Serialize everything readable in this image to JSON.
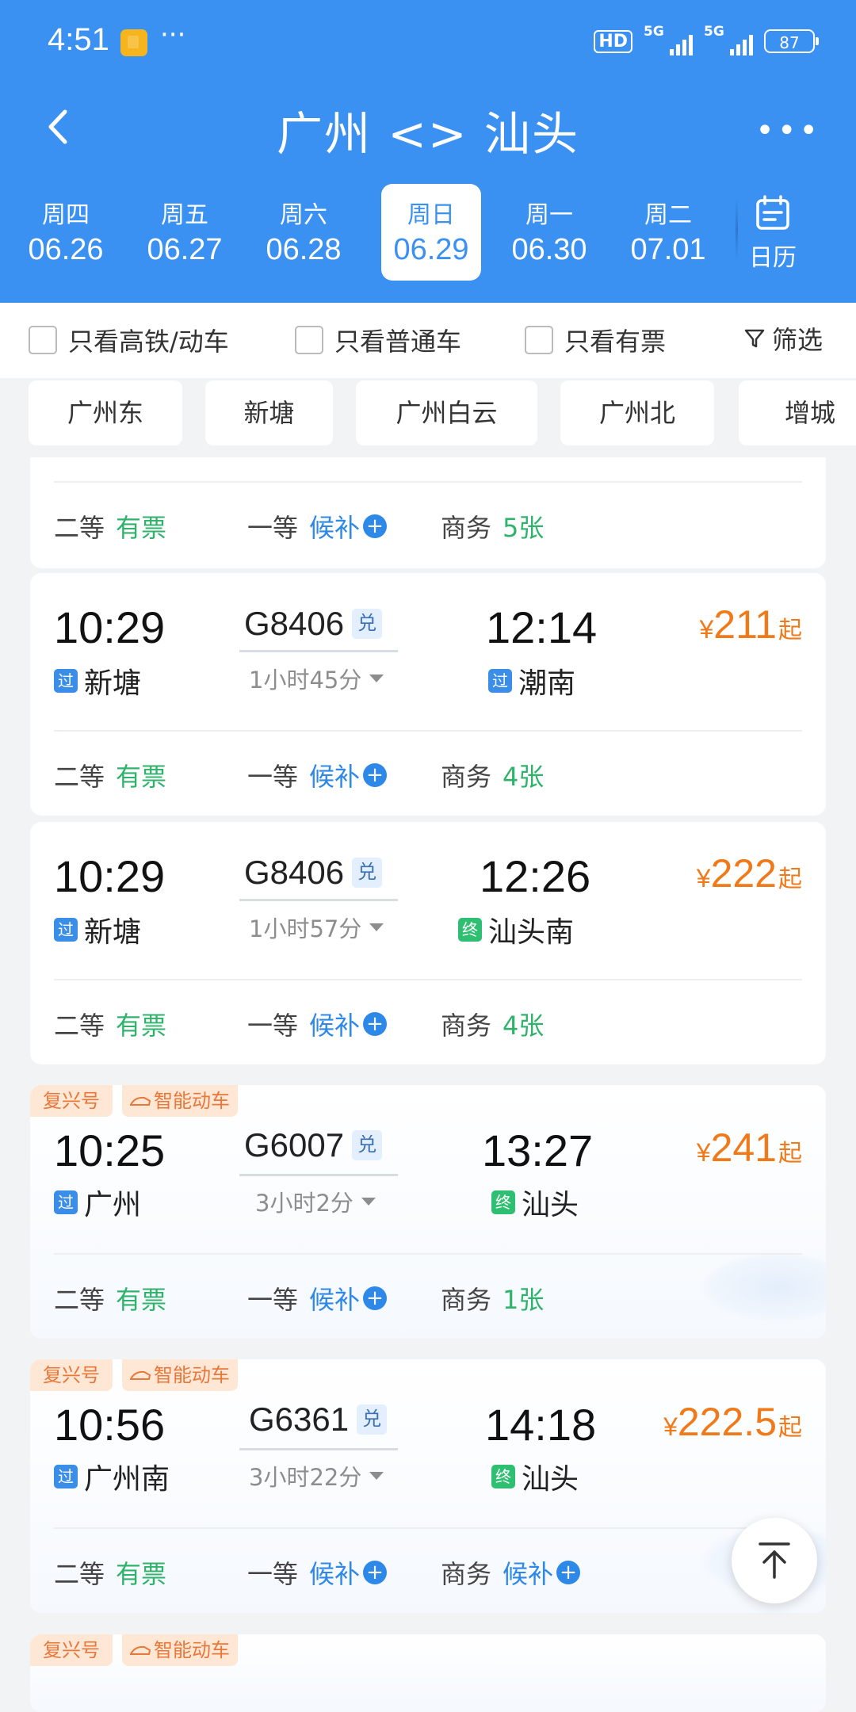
{
  "status_bar": {
    "time": "4:51",
    "dots": "···",
    "hd": "HD",
    "net1": "5G",
    "net2": "5G",
    "battery": "87"
  },
  "header": {
    "title": "广州 <> 汕头",
    "more": "•••"
  },
  "dates": [
    {
      "weekday": "周四",
      "date": "06.26"
    },
    {
      "weekday": "周五",
      "date": "06.27"
    },
    {
      "weekday": "周六",
      "date": "06.28"
    },
    {
      "weekday": "周日",
      "date": "06.29",
      "active": true
    },
    {
      "weekday": "周一",
      "date": "06.30"
    },
    {
      "weekday": "周二",
      "date": "07.01"
    }
  ],
  "calendar_label": "日历",
  "filters": {
    "high_speed": "只看高铁/动车",
    "normal": "只看普通车",
    "available": "只看有票",
    "filter_label": "筛选"
  },
  "stations": [
    "广州东",
    "新塘",
    "广州白云",
    "广州北",
    "增城"
  ],
  "seat_labels": {
    "second": "二等",
    "first": "一等",
    "business": "商务"
  },
  "partial_card": {
    "second": "有票",
    "first": "候补",
    "business": "5张"
  },
  "badges": {
    "fuxing": "复兴号",
    "smart": "智能动车"
  },
  "trains": [
    {
      "dep_time": "10:29",
      "dep_tag": "过",
      "dep_station": "新塘",
      "train_no": "G8406",
      "dui": "兑",
      "duration": "1小时45分",
      "arr_time": "12:14",
      "arr_tag": "过",
      "arr_station": "潮南",
      "currency": "¥",
      "price": "211",
      "price_suffix": "起",
      "second": "有票",
      "first": "候补",
      "business": "4张"
    },
    {
      "dep_time": "10:29",
      "dep_tag": "过",
      "dep_station": "新塘",
      "train_no": "G8406",
      "dui": "兑",
      "duration": "1小时57分",
      "arr_time": "12:26",
      "arr_tag": "终",
      "arr_station": "汕头南",
      "currency": "¥",
      "price": "222",
      "price_suffix": "起",
      "second": "有票",
      "first": "候补",
      "business": "4张"
    },
    {
      "dep_time": "10:25",
      "dep_tag": "过",
      "dep_station": "广州",
      "train_no": "G6007",
      "dui": "兑",
      "duration": "3小时2分",
      "arr_time": "13:27",
      "arr_tag": "终",
      "arr_station": "汕头",
      "currency": "¥",
      "price": "241",
      "price_suffix": "起",
      "second": "有票",
      "first": "候补",
      "business": "1张"
    },
    {
      "dep_time": "10:56",
      "dep_tag": "过",
      "dep_station": "广州南",
      "train_no": "G6361",
      "dui": "兑",
      "duration": "3小时22分",
      "arr_time": "14:18",
      "arr_tag": "终",
      "arr_station": "汕头",
      "currency": "¥",
      "price": "222.5",
      "price_suffix": "起",
      "second": "有票",
      "first": "候补",
      "business": "候补"
    }
  ]
}
